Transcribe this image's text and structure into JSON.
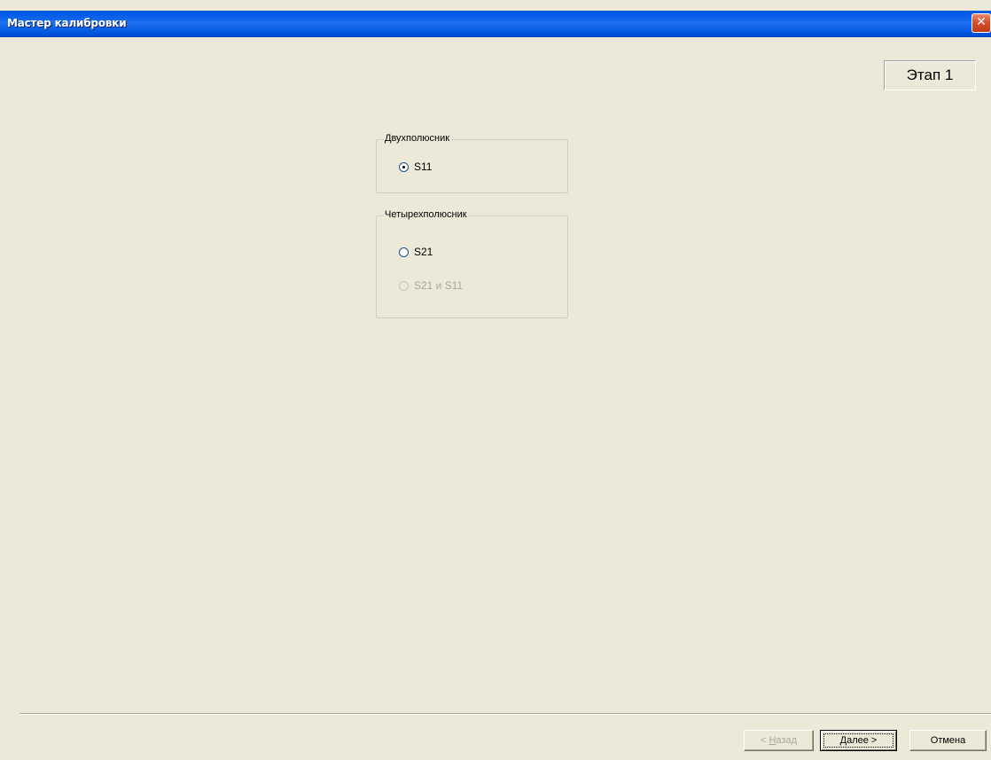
{
  "window": {
    "title": "Мастер калибровки",
    "close_label": "✕"
  },
  "stage": {
    "label": "Этап 1"
  },
  "groups": [
    {
      "legend": "Двухполюсник",
      "options": [
        {
          "label": "S11",
          "checked": true,
          "enabled": true
        }
      ]
    },
    {
      "legend": "Четырехполюсник",
      "options": [
        {
          "label": "S21",
          "checked": false,
          "enabled": true
        },
        {
          "label": "S21 и S11",
          "checked": false,
          "enabled": false
        }
      ]
    }
  ],
  "buttons": {
    "back_prefix": "< ",
    "back_hotkey": "Н",
    "back_rest": "азад",
    "next_hotkey": "Д",
    "next_rest": "алее >",
    "cancel": "Отмена"
  },
  "colors": {
    "background": "#ECE9D8",
    "titlebar": "#0058E6",
    "close_button": "#D8502C",
    "disabled_text": "#ACA899"
  }
}
